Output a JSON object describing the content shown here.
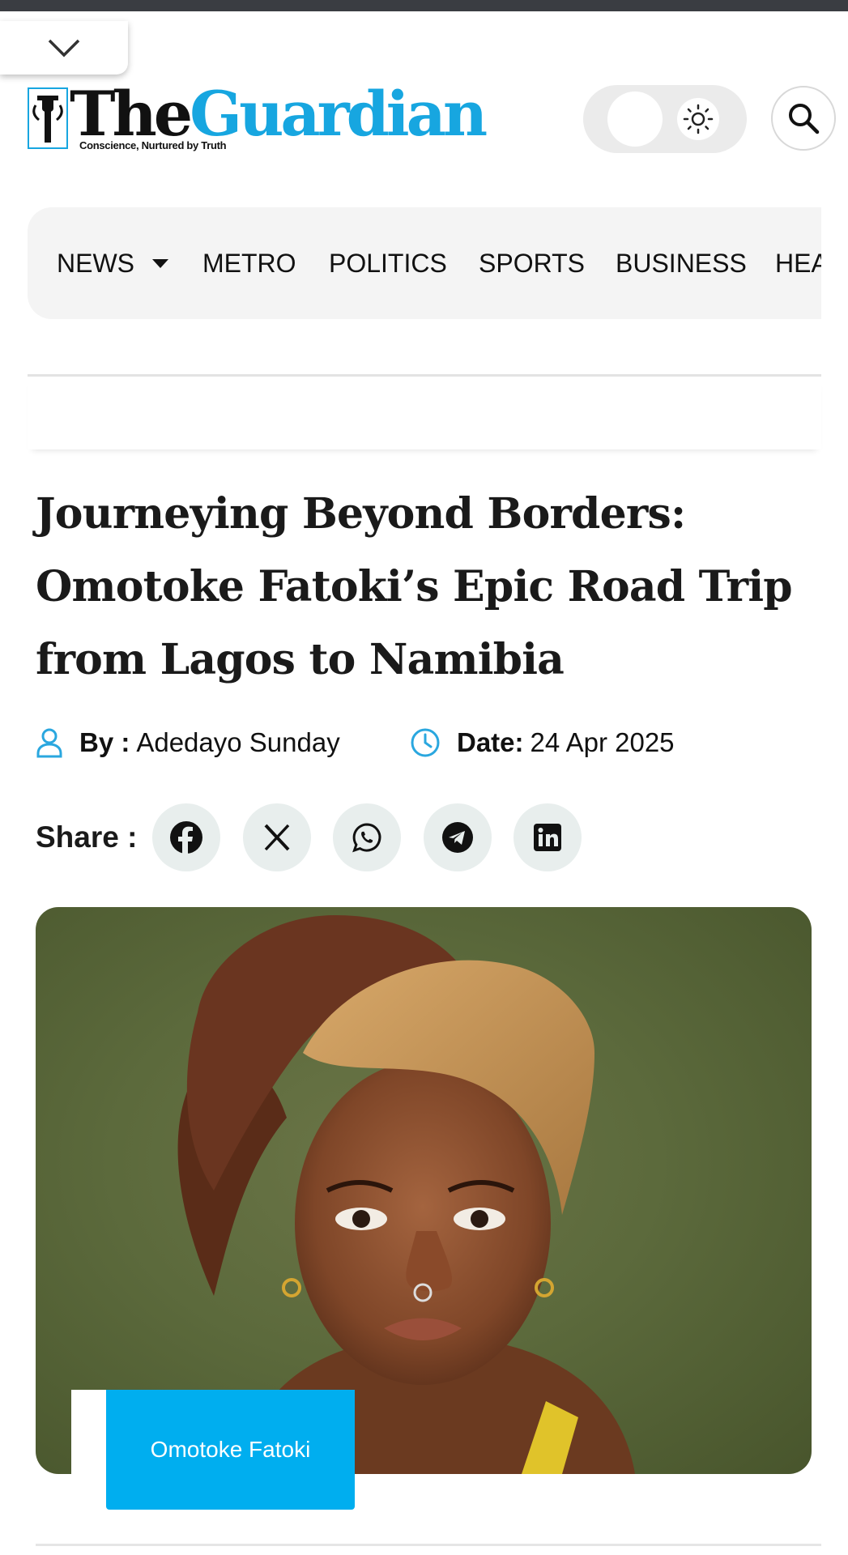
{
  "colors": {
    "brand_blue": "#17a6e0",
    "caption_blue": "#00aeef",
    "meta_icon_blue": "#2aa7df",
    "text": "#111111"
  },
  "header": {
    "collapse_icon": "chevron-down-icon",
    "logo": {
      "the": "The",
      "guardian": "Guardian",
      "tagline": "Conscience, Nurtured by Truth"
    },
    "theme_icon": "sun-icon",
    "search_icon": "search-icon"
  },
  "nav": {
    "items": [
      {
        "label": "NEWS",
        "icon": "caret-down-icon"
      },
      {
        "label": "METRO"
      },
      {
        "label": "POLITICS"
      },
      {
        "label": "SPORTS"
      },
      {
        "label": "BUSINESS"
      },
      {
        "label": "HEA"
      }
    ]
  },
  "article": {
    "title": "Journeying Beyond Borders: Omotoke Fatoki’s Epic Road Trip from Lagos to Namibia",
    "byline_label": "By :",
    "author": "Adedayo Sunday",
    "date_label": "Date:",
    "date": "24 Apr 2025",
    "share_label": "Share :",
    "share_buttons": [
      "facebook-icon",
      "x-icon",
      "whatsapp-icon",
      "telegram-icon",
      "linkedin-icon"
    ],
    "image_caption": "Omotoke Fatoki"
  }
}
